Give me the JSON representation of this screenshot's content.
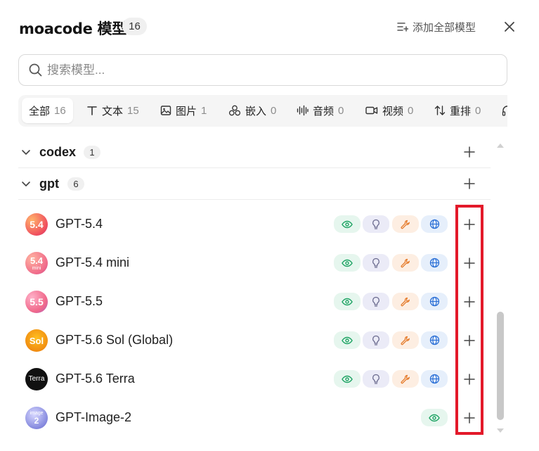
{
  "header": {
    "title": "moacode 模型",
    "count": "16",
    "add_all_label": "添加全部模型"
  },
  "search": {
    "placeholder": "搜索模型..."
  },
  "tabs": [
    {
      "label": "全部",
      "count": "16",
      "icon": "all"
    },
    {
      "label": "文本",
      "count": "15",
      "icon": "text-icon"
    },
    {
      "label": "图片",
      "count": "1",
      "icon": "image-icon"
    },
    {
      "label": "嵌入",
      "count": "0",
      "icon": "embedding-icon"
    },
    {
      "label": "音频",
      "count": "0",
      "icon": "audio-wave-icon"
    },
    {
      "label": "视频",
      "count": "0",
      "icon": "video-icon"
    },
    {
      "label": "重排",
      "count": "0",
      "icon": "rerank-icon"
    }
  ],
  "groups": [
    {
      "name": "codex",
      "count": "1",
      "expanded": false
    },
    {
      "name": "gpt",
      "count": "6",
      "expanded": true
    }
  ],
  "models": [
    {
      "name": "GPT-5.4",
      "avatar_text": "5.4",
      "avatar_sub": "",
      "capabilities": [
        "vision",
        "reasoning",
        "tools",
        "web"
      ]
    },
    {
      "name": "GPT-5.4 mini",
      "avatar_text": "5.4",
      "avatar_sub": "mini",
      "capabilities": [
        "vision",
        "reasoning",
        "tools",
        "web"
      ]
    },
    {
      "name": "GPT-5.5",
      "avatar_text": "5.5",
      "avatar_sub": "",
      "capabilities": [
        "vision",
        "reasoning",
        "tools",
        "web"
      ]
    },
    {
      "name": "GPT-5.6 Sol (Global)",
      "avatar_text": "Sol",
      "avatar_sub": "",
      "capabilities": [
        "vision",
        "reasoning",
        "tools",
        "web"
      ]
    },
    {
      "name": "GPT-5.6 Terra",
      "avatar_text": "Terra",
      "avatar_sub": "",
      "capabilities": [
        "vision",
        "reasoning",
        "tools",
        "web"
      ]
    },
    {
      "name": "GPT-Image-2",
      "avatar_text": "image",
      "avatar_sub": "2",
      "capabilities": [
        "vision"
      ]
    }
  ],
  "colors": {
    "highlight": "#e3192a",
    "vision": "#1fa464",
    "reasoning": "#6b6b8f",
    "tools": "#e57b2b",
    "web": "#2a6fd6"
  }
}
